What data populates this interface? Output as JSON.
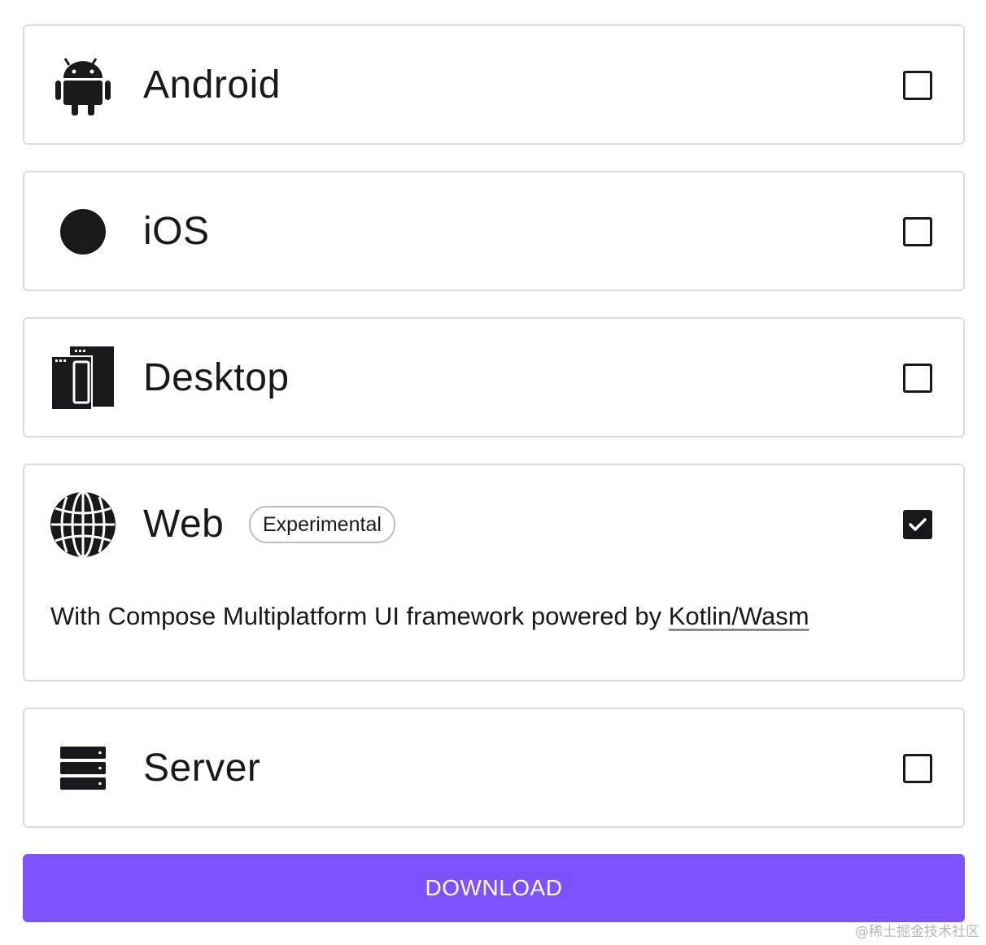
{
  "platforms": [
    {
      "id": "android",
      "label": "Android",
      "icon": "android-icon",
      "checked": false
    },
    {
      "id": "ios",
      "label": "iOS",
      "icon": "apple-icon",
      "checked": false
    },
    {
      "id": "desktop",
      "label": "Desktop",
      "icon": "desktop-icon",
      "checked": false
    },
    {
      "id": "web",
      "label": "Web",
      "icon": "globe-icon",
      "checked": true,
      "badge": "Experimental",
      "description": "With Compose Multiplatform UI framework powered by ",
      "description_link": "Kotlin/Wasm"
    },
    {
      "id": "server",
      "label": "Server",
      "icon": "server-icon",
      "checked": false
    }
  ],
  "download_label": "DOWNLOAD",
  "watermark": "@稀土掘金技术社区",
  "colors": {
    "accent": "#7f52ff",
    "text": "#19191c",
    "border": "#dcdcdf"
  }
}
